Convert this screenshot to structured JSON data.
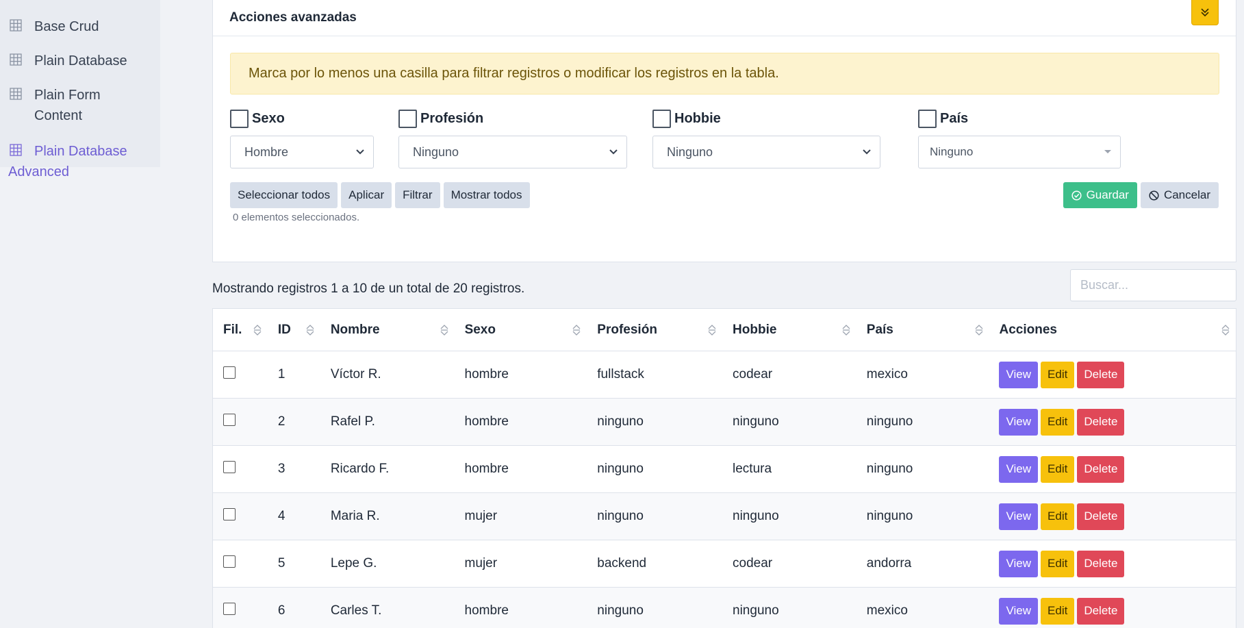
{
  "sidebar": {
    "items": [
      {
        "label": "Base Crud",
        "icon": "table-grid-icon"
      },
      {
        "label": "Plain Database",
        "icon": "table-grid-icon"
      },
      {
        "label": "Plain Form Content",
        "icon": "table-grid-icon"
      },
      {
        "label": "Plain Database Advanced",
        "icon": "table-grid-icon",
        "active": true
      }
    ]
  },
  "panel": {
    "title": "Acciones avanzadas",
    "alert": "Marca por lo menos una casilla para filtrar registros o modificar los registros en la tabla.",
    "filters": [
      {
        "label": "Sexo",
        "value": "Hombre"
      },
      {
        "label": "Profesión",
        "value": "Ninguno"
      },
      {
        "label": "Hobbie",
        "value": "Ninguno"
      },
      {
        "label": "País",
        "value": "Ninguno"
      }
    ],
    "buttons": {
      "select_all": "Seleccionar todos",
      "apply": "Aplicar",
      "filter": "Filtrar",
      "show_all": "Mostrar todos",
      "save": "Guardar",
      "cancel": "Cancelar"
    },
    "selected_count": "0 elementos seleccionados."
  },
  "table_info": {
    "showing": "Mostrando registros 1 a 10 de un total de 20 registros.",
    "search_placeholder": "Buscar..."
  },
  "table": {
    "columns": [
      "Fil.",
      "ID",
      "Nombre",
      "Sexo",
      "Profesión",
      "Hobbie",
      "País",
      "Acciones"
    ],
    "action_labels": {
      "view": "View",
      "edit": "Edit",
      "delete": "Delete"
    },
    "rows": [
      {
        "id": "1",
        "nombre": "Víctor R.",
        "sexo": "hombre",
        "profesion": "fullstack",
        "hobbie": "codear",
        "pais": "mexico"
      },
      {
        "id": "2",
        "nombre": "Rafel P.",
        "sexo": "hombre",
        "profesion": "ninguno",
        "hobbie": "ninguno",
        "pais": "ninguno"
      },
      {
        "id": "3",
        "nombre": "Ricardo F.",
        "sexo": "hombre",
        "profesion": "ninguno",
        "hobbie": "lectura",
        "pais": "ninguno"
      },
      {
        "id": "4",
        "nombre": "Maria R.",
        "sexo": "mujer",
        "profesion": "ninguno",
        "hobbie": "ninguno",
        "pais": "ninguno"
      },
      {
        "id": "5",
        "nombre": "Lepe G.",
        "sexo": "mujer",
        "profesion": "backend",
        "hobbie": "codear",
        "pais": "andorra"
      },
      {
        "id": "6",
        "nombre": "Carles T.",
        "sexo": "hombre",
        "profesion": "ninguno",
        "hobbie": "ninguno",
        "pais": "mexico"
      }
    ]
  },
  "colors": {
    "accent": "#6d5dd3",
    "warning": "#f7c10c",
    "success": "#3dbf8a",
    "danger": "#e04858",
    "view": "#7c68ee"
  }
}
